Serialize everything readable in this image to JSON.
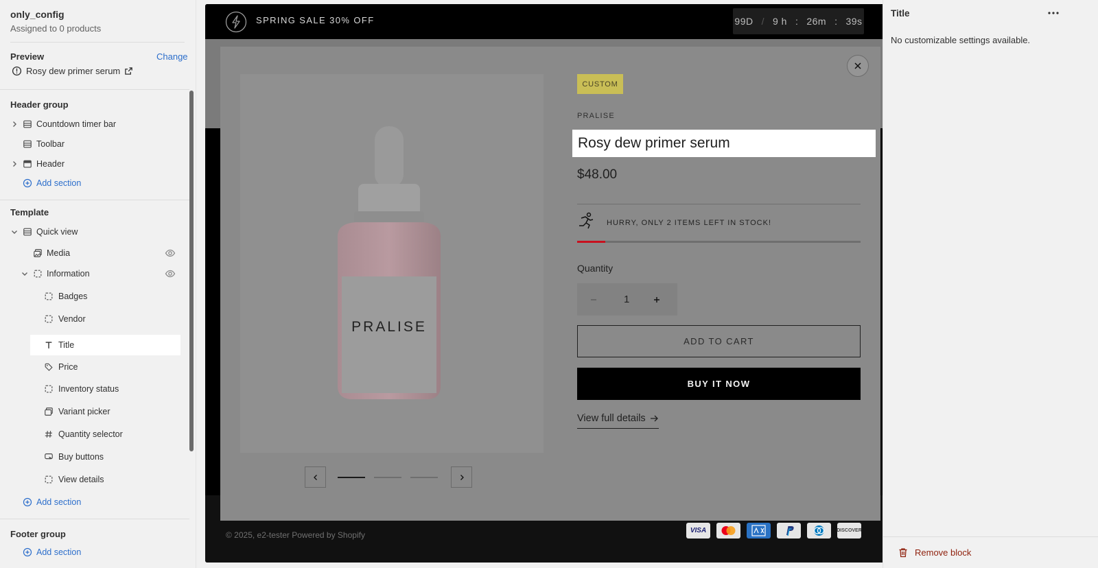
{
  "left_panel": {
    "theme_name": "only_config",
    "assigned": "Assigned to 0 products",
    "preview_label": "Preview",
    "change_label": "Change",
    "preview_product": "Rosy dew primer serum",
    "header_group": {
      "label": "Header group",
      "items": [
        "Countdown timer bar",
        "Toolbar",
        "Header"
      ],
      "add_section": "Add section"
    },
    "template": {
      "label": "Template",
      "section": "Quick view",
      "blocks": [
        "Media",
        "Information"
      ],
      "sub_blocks": [
        "Badges",
        "Vendor",
        "Title",
        "Price",
        "Inventory status",
        "Variant picker",
        "Quantity selector",
        "Buy buttons",
        "View details"
      ],
      "selected": "Title",
      "add_section": "Add section"
    },
    "footer_group": {
      "label": "Footer group",
      "add_section": "Add section"
    }
  },
  "right_panel": {
    "title": "Title",
    "message": "No customizable settings available.",
    "remove_label": "Remove block"
  },
  "preview": {
    "announcement": "SPRING SALE 30% OFF",
    "timer": {
      "days": "99D",
      "hours": "9 h",
      "minutes": "26m",
      "seconds": "39s",
      "sep": ":"
    },
    "footer_text": "© 2025, e2-tester Powered by Shopify",
    "payment_icons": [
      "VISA",
      "mastercard",
      "amex",
      "paypal",
      "diners",
      "DISCOVER"
    ],
    "modal": {
      "badge": "CUSTOM",
      "vendor": "PRALISE",
      "product_title": "Rosy dew primer serum",
      "bottle_label": "PRALISE",
      "price": "$48.00",
      "stock_message": "HURRY, ONLY 2 ITEMS LEFT IN STOCK!",
      "stock_level": 0.1,
      "quantity_label": "Quantity",
      "quantity": "1",
      "add_to_cart": "ADD TO CART",
      "buy_now": "BUY IT NOW",
      "view_details": "View full details",
      "slides_total": 3,
      "slide_active": 1
    }
  },
  "colors": {
    "link": "#2c6ecb",
    "danger": "#8e1f0b",
    "badge": "#c9be56",
    "stock_bar": "#c8101e"
  }
}
